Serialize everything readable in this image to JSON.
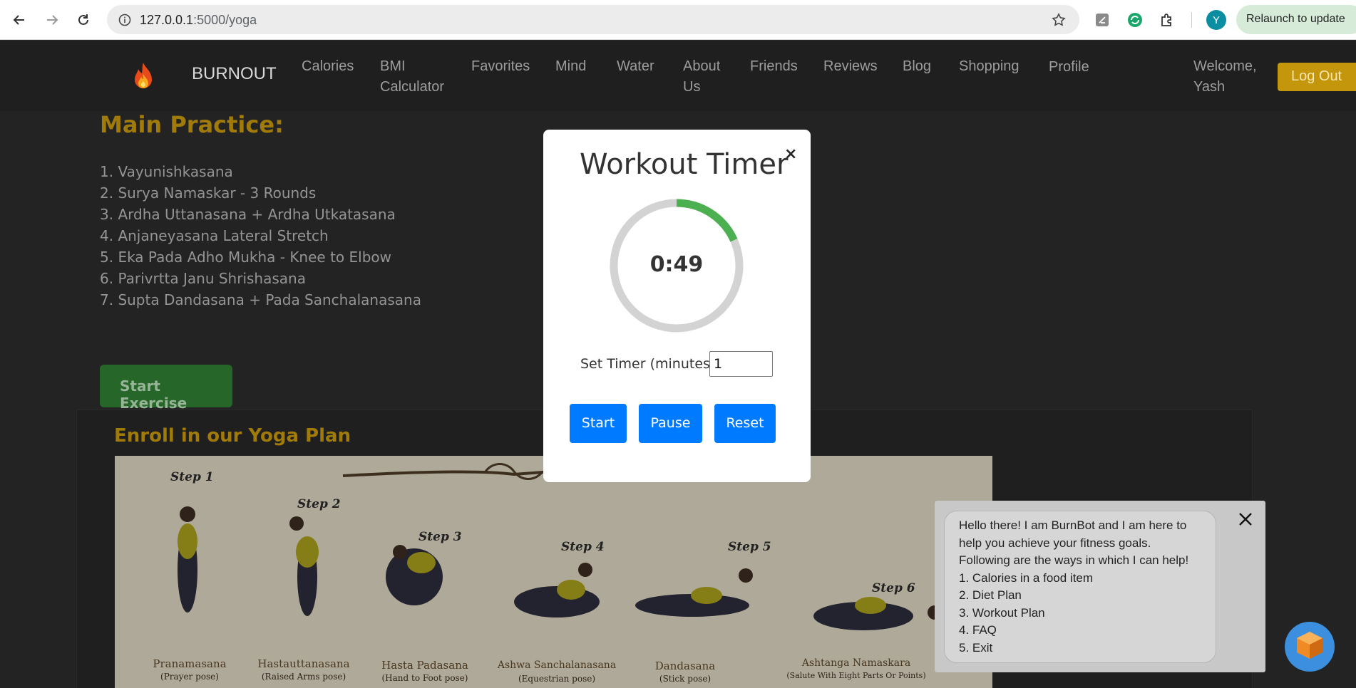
{
  "browser": {
    "url_host": "127.0.0.1",
    "url_path": ":5000/yoga",
    "profile_initial": "Y",
    "relaunch_label": "Relaunch to update"
  },
  "nav": {
    "brand": "BURNOUT",
    "links": [
      "Calories",
      "BMI Calculator",
      "Favorites",
      "Mind",
      "Water",
      "About Us",
      "Friends",
      "Reviews",
      "Blog",
      "Shopping",
      "Profile"
    ],
    "welcome": "Welcome, Yash",
    "logout": "Log Out"
  },
  "page": {
    "main_heading": "Main Practice:",
    "practice_items": [
      "1. Vayunishkasana",
      "2. Surya Namaskar - 3 Rounds",
      "3. Ardha Uttanasana + Ardha Utkatasana",
      "4. Anjaneyasana Lateral Stretch",
      "5. Eka Pada Adho Mukha - Knee to Elbow",
      "6. Parivrtta Janu Shrishasana",
      "7. Supta Dandasana + Pada Sanchalanasana"
    ],
    "start_exercise": "Start Exercise",
    "enroll_heading": "Enroll in our Yoga Plan",
    "yoga_steps": [
      {
        "step": "Step 1",
        "name": "Pranamasana",
        "sub": "(Prayer pose)"
      },
      {
        "step": "Step 2",
        "name": "Hastauttanasana",
        "sub": "(Raised Arms pose)"
      },
      {
        "step": "Step 3",
        "name": "Hasta Padasana",
        "sub": "(Hand to Foot pose)"
      },
      {
        "step": "Step 4",
        "name": "Ashwa Sanchalanasana",
        "sub": "(Equestrian pose)"
      },
      {
        "step": "Step 5",
        "name": "Dandasana",
        "sub": "(Stick pose)"
      },
      {
        "step": "Step 6",
        "name": "Ashtanga Namaskara",
        "sub": "(Salute With Eight Parts Or Points)"
      }
    ]
  },
  "timer_modal": {
    "title": "Workout Timer",
    "close": "×",
    "time_display": "0:49",
    "progress_fraction": 0.1833,
    "label": "Set Timer (minutes):",
    "input_value": "1",
    "start": "Start",
    "pause": "Pause",
    "reset": "Reset",
    "colors": {
      "progress": "#4caf50",
      "track": "#d3d3d3",
      "button": "#007bff"
    }
  },
  "chatbot": {
    "lines": [
      "Hello there! I am BurnBot and I am here to",
      "help you achieve your fitness goals.",
      "Following are the ways in which I can help!",
      "1. Calories in a food item",
      "2. Diet Plan",
      "3. Workout Plan",
      "4. FAQ",
      "5. Exit"
    ]
  }
}
